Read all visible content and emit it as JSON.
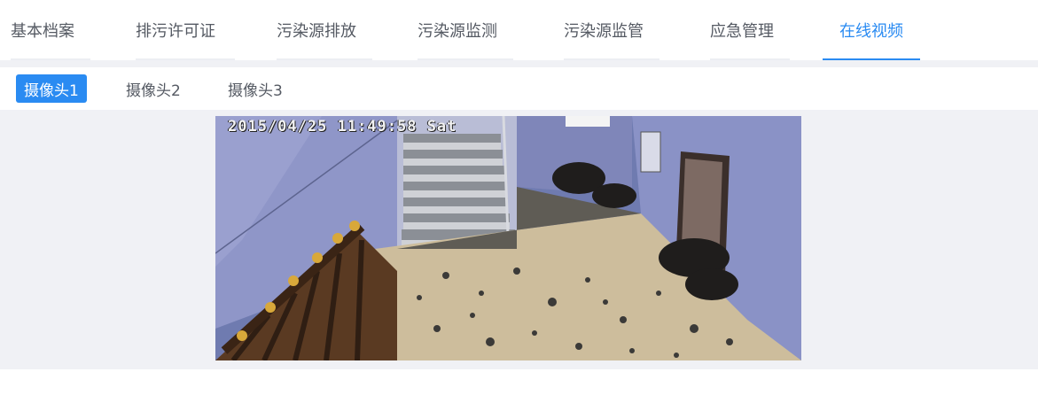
{
  "tabs": [
    {
      "label": "基本档案",
      "active": false
    },
    {
      "label": "排污许可证",
      "active": false
    },
    {
      "label": "污染源排放",
      "active": false
    },
    {
      "label": "污染源监测",
      "active": false
    },
    {
      "label": "污染源监管",
      "active": false
    },
    {
      "label": "应急管理",
      "active": false
    },
    {
      "label": "在线视频",
      "active": true
    }
  ],
  "camera_tabs": [
    {
      "label": "摄像头1",
      "active": true
    },
    {
      "label": "摄像头2",
      "active": false
    },
    {
      "label": "摄像头3",
      "active": false
    }
  ],
  "video": {
    "osd_timestamp": "2015/04/25 11:49:58 Sat"
  },
  "colors": {
    "accent": "#2a8bf2",
    "tab_text": "#555a63",
    "page_bg": "#f0f1f5"
  }
}
